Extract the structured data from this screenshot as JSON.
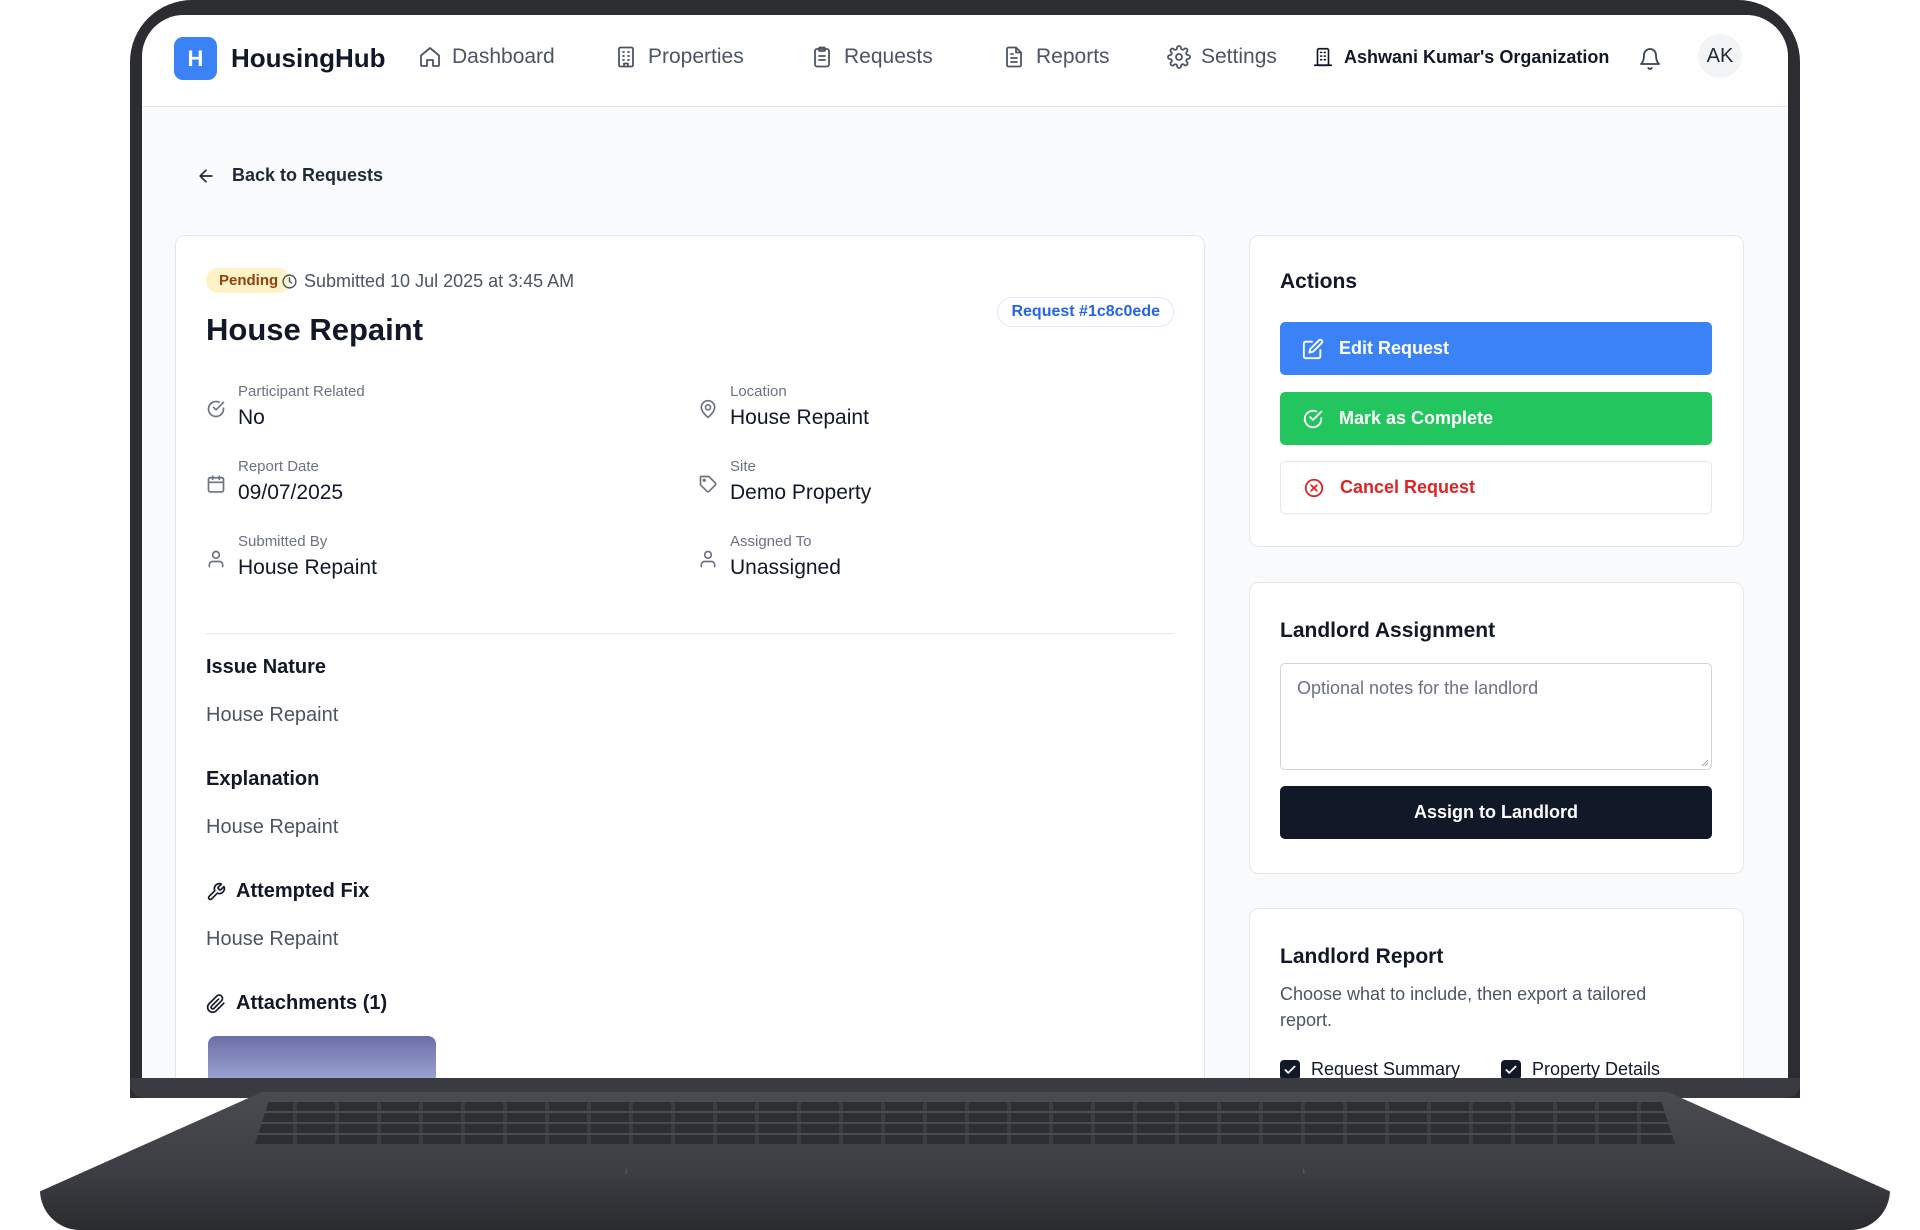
{
  "nav": {
    "brand": "HousingHub",
    "brand_initial": "H",
    "items": [
      {
        "label": "Dashboard",
        "icon": "home-icon"
      },
      {
        "label": "Properties",
        "icon": "building-icon"
      },
      {
        "label": "Requests",
        "icon": "clipboard-icon"
      },
      {
        "label": "Reports",
        "icon": "document-icon"
      },
      {
        "label": "Settings",
        "icon": "gear-icon"
      }
    ],
    "organization": "Ashwani Kumar's Organization",
    "avatar_initials": "AK"
  },
  "back_label": "Back to Requests",
  "request": {
    "status": "Pending",
    "submitted": "Submitted 10 Jul 2025 at 3:45 AM",
    "request_id": "Request #1c8c0ede",
    "title": "House Repaint",
    "fields": {
      "participant_related": {
        "label": "Participant Related",
        "value": "No"
      },
      "location": {
        "label": "Location",
        "value": "House Repaint"
      },
      "report_date": {
        "label": "Report Date",
        "value": "09/07/2025"
      },
      "site": {
        "label": "Site",
        "value": "Demo Property"
      },
      "submitted_by": {
        "label": "Submitted By",
        "value": "House Repaint"
      },
      "assigned_to": {
        "label": "Assigned To",
        "value": "Unassigned"
      }
    },
    "issue_nature": {
      "heading": "Issue Nature",
      "text": "House Repaint"
    },
    "explanation": {
      "heading": "Explanation",
      "text": "House Repaint"
    },
    "attempted_fix": {
      "heading": "Attempted Fix",
      "text": "House Repaint"
    },
    "attachments": {
      "heading": "Attachments (1)"
    }
  },
  "actions": {
    "title": "Actions",
    "edit": "Edit Request",
    "complete": "Mark as Complete",
    "cancel": "Cancel Request"
  },
  "landlord_assignment": {
    "title": "Landlord Assignment",
    "notes_placeholder": "Optional notes for the landlord",
    "assign_button": "Assign to Landlord"
  },
  "landlord_report": {
    "title": "Landlord Report",
    "description": "Choose what to include, then export a tailored report.",
    "options": [
      {
        "label": "Request Summary",
        "checked": true
      },
      {
        "label": "Property Details",
        "checked": true
      }
    ]
  },
  "colors": {
    "primary": "#3b82f6",
    "success": "#22c55e",
    "danger": "#dc2626",
    "dark": "#111827",
    "pending_bg": "#fef3c7",
    "pending_text": "#92400e"
  }
}
